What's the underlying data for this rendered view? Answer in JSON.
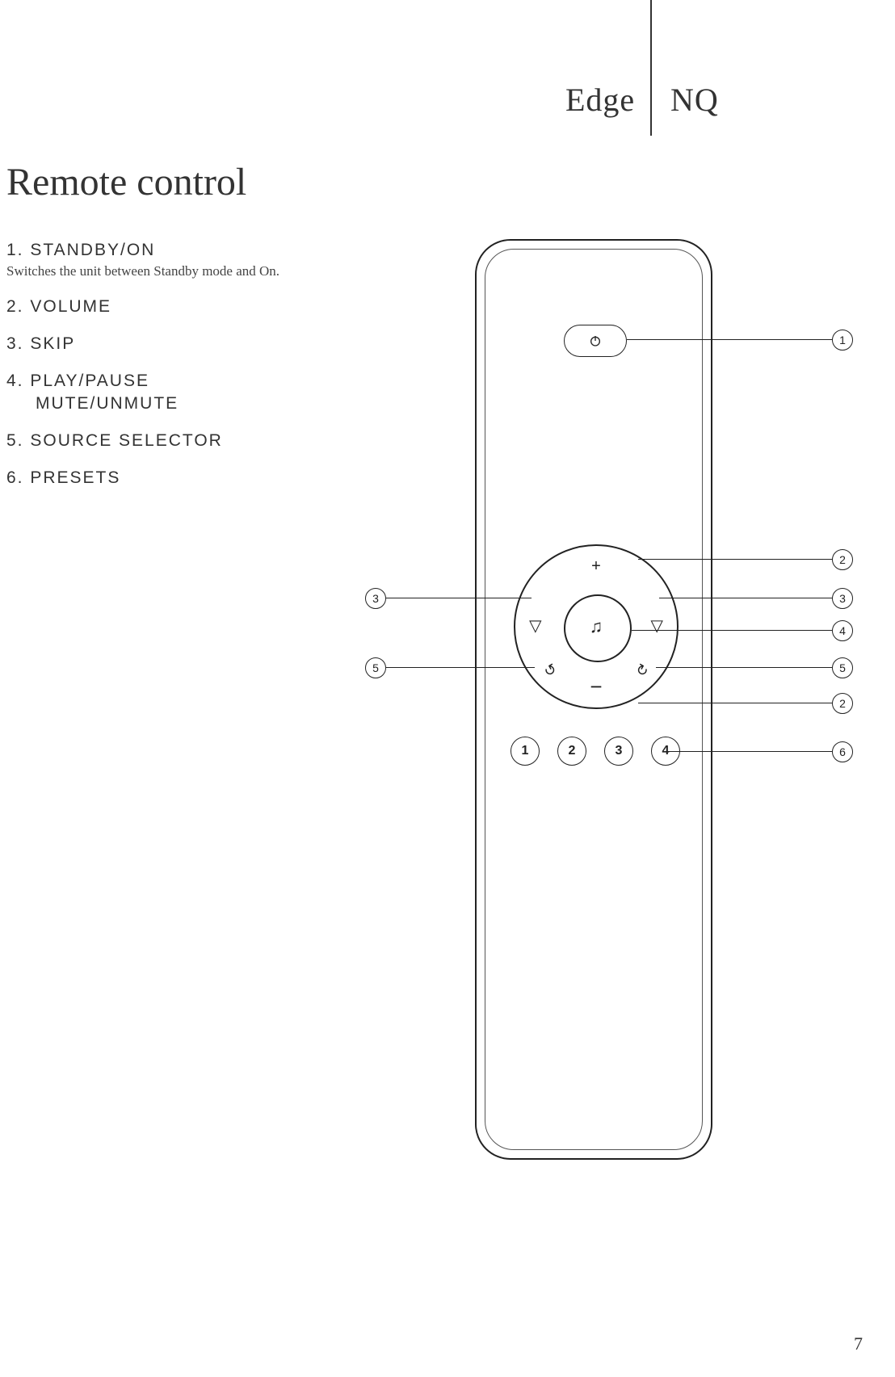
{
  "header": {
    "left": "Edge",
    "right": "NQ"
  },
  "title": "Remote control",
  "items": [
    {
      "n": "1.",
      "label": "STANDBY/ON",
      "desc": "Switches the unit between Standby mode and On."
    },
    {
      "n": "2.",
      "label": "VOLUME"
    },
    {
      "n": "3.",
      "label": "SKIP"
    },
    {
      "n": "4.",
      "label": "PLAY/PAUSE",
      "sublabel": "MUTE/UNMUTE"
    },
    {
      "n": "5.",
      "label": "SOURCE SELECTOR"
    },
    {
      "n": "6.",
      "label": "PRESETS"
    }
  ],
  "pad": {
    "plus": "+",
    "minus": "−",
    "skip_left": "◁",
    "skip_right": "▷",
    "music": "♫",
    "src_a": "↺",
    "src_b": "↻"
  },
  "presets": [
    "1",
    "2",
    "3",
    "4"
  ],
  "callouts": {
    "right": [
      "1",
      "2",
      "3",
      "4",
      "5",
      "2",
      "6"
    ],
    "left": [
      "3",
      "5"
    ]
  },
  "page_number": "7"
}
